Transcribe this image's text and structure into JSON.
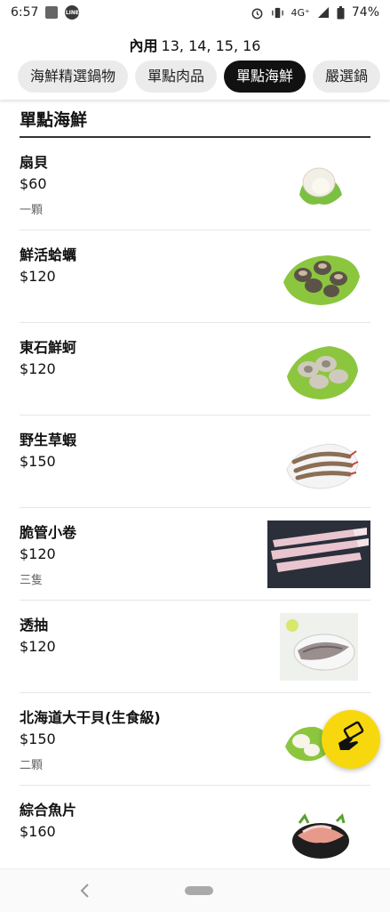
{
  "status_bar": {
    "time": "6:57",
    "network": "4G⁺",
    "battery": "74%",
    "app_badge": "LINE"
  },
  "header": {
    "table_label": "內用",
    "table_numbers": "13, 14, 15, 16",
    "tabs": [
      {
        "label": "海鮮精選鍋物",
        "active": false
      },
      {
        "label": "單點肉品",
        "active": false
      },
      {
        "label": "單點海鮮",
        "active": true
      },
      {
        "label": "嚴選鍋",
        "active": false
      }
    ]
  },
  "section": {
    "title": "單點海鮮",
    "items": [
      {
        "name": "扇貝",
        "price": "$60",
        "note": "一顆",
        "image": "scallop-on-lettuce"
      },
      {
        "name": "鮮活蛤蠣",
        "price": "$120",
        "note": "",
        "image": "clams-on-lettuce"
      },
      {
        "name": "東石鮮蚵",
        "price": "$120",
        "note": "",
        "image": "oysters-on-lettuce"
      },
      {
        "name": "野生草蝦",
        "price": "$150",
        "note": "",
        "image": "shrimp-platter"
      },
      {
        "name": "脆管小卷",
        "price": "$120",
        "note": "三隻",
        "image": "squid-photo"
      },
      {
        "name": "透抽",
        "price": "$120",
        "note": "",
        "image": "squid-on-plate"
      },
      {
        "name": "北海道大干貝(生食級)",
        "price": "$150",
        "note": "二顆",
        "image": "scallops-on-lettuce"
      },
      {
        "name": "綜合魚片",
        "price": "$160",
        "note": "",
        "image": "fish-slices-bowl"
      }
    ]
  },
  "colors": {
    "accent_dark": "#111111",
    "fab": "#f7d80f",
    "tab_bg": "#ebebeb"
  },
  "fab": {
    "icon": "hand-money-icon"
  }
}
